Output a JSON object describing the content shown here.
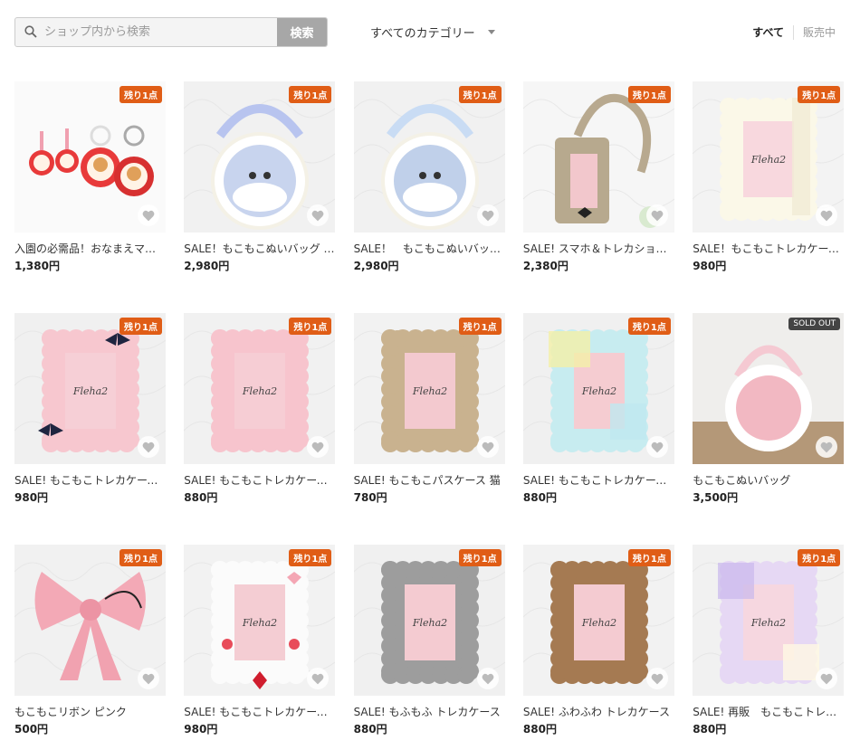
{
  "search": {
    "placeholder": "ショップ内から検索",
    "button_label": "検索",
    "icon": "search-icon"
  },
  "category": {
    "label": "すべてのカテゴリー",
    "icon": "caret-down-icon"
  },
  "filters": {
    "all": "すべて",
    "on_sale": "販売中"
  },
  "colors": {
    "badge": "#e05d16",
    "soldout_badge": "#444444",
    "search_button": "#a7a7a7"
  },
  "products": [
    {
      "title": "入園の必需品！おなまえマー…",
      "price": "1,380円",
      "badge": "残り1点",
      "art": "keychains"
    },
    {
      "title": "SALE！もこもこぬいバッグ ミ…",
      "price": "2,980円",
      "badge": "残り1点",
      "art": "bag-doll"
    },
    {
      "title": "SALE！　もこもこぬいバッグ …",
      "price": "2,980円",
      "badge": "残り1点",
      "art": "bag-doll2"
    },
    {
      "title": "SALE! スマホ＆トレカショル…",
      "price": "2,380円",
      "badge": "残り1点",
      "art": "phone-pouch"
    },
    {
      "title": "SALE！もこもこトレカケース…",
      "price": "980円",
      "badge": "残り1点",
      "art": "frame-cream"
    },
    {
      "title": "SALE! もこもこトレカケース…",
      "price": "980円",
      "badge": "残り1点",
      "art": "frame-pink-bow"
    },
    {
      "title": "SALE! もこもこトレカケース …",
      "price": "880円",
      "badge": "残り1点",
      "art": "frame-pink"
    },
    {
      "title": "SALE! もこもこパスケース 猫",
      "price": "780円",
      "badge": "残り1点",
      "art": "frame-beige-cat"
    },
    {
      "title": "SALE! もこもこトレカケース …",
      "price": "880円",
      "badge": "残り1点",
      "art": "frame-rainbow"
    },
    {
      "title": "もこもこぬいバッグ",
      "price": "3,500円",
      "badge": "SOLD OUT",
      "art": "bag-pink"
    },
    {
      "title": "もこもこリボン ピンク",
      "price": "500円",
      "badge": "残り1点",
      "art": "ribbon"
    },
    {
      "title": "SALE! もこもこトレカケース …",
      "price": "980円",
      "badge": "残り1点",
      "art": "frame-white-deco"
    },
    {
      "title": "SALE! もふもふ トレカケース",
      "price": "880円",
      "badge": "残り1点",
      "art": "frame-grey"
    },
    {
      "title": "SALE! ふわふわ トレカケース",
      "price": "880円",
      "badge": "残り1点",
      "art": "frame-brown"
    },
    {
      "title": "SALE! 再販　もこもこトレカ…",
      "price": "880円",
      "badge": "残り1点",
      "art": "frame-lavender"
    }
  ]
}
